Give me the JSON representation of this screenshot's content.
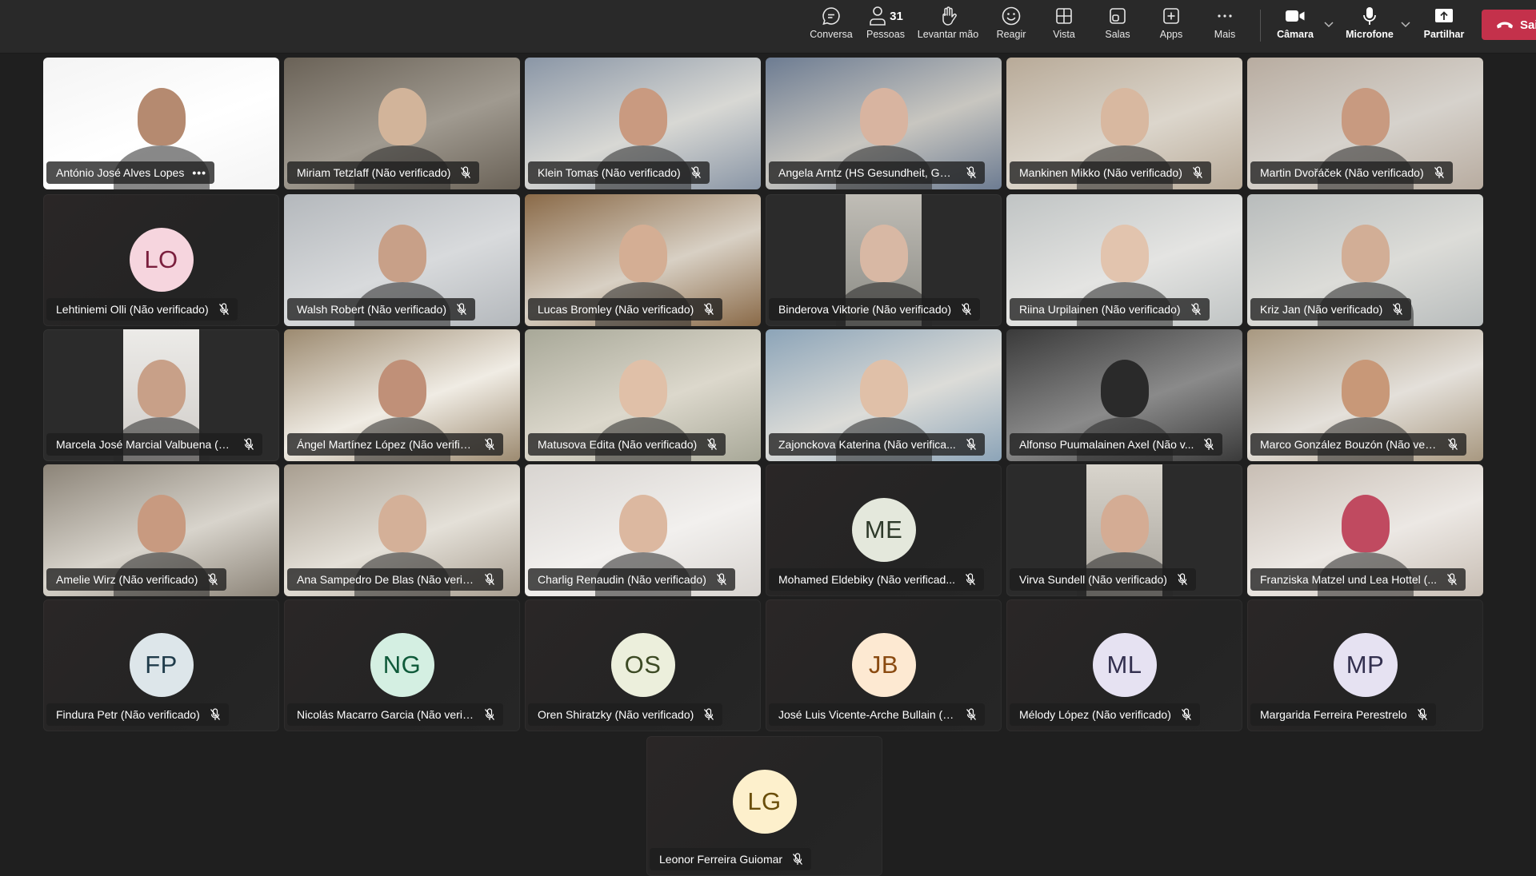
{
  "toolbar": {
    "chat": {
      "label": "Conversa",
      "icon": "chat-icon"
    },
    "people": {
      "label": "Pessoas",
      "count": "31",
      "icon": "people-icon"
    },
    "raise_hand": {
      "label": "Levantar mão",
      "icon": "raise-hand-icon"
    },
    "react": {
      "label": "Reagir",
      "icon": "smiley-icon"
    },
    "view": {
      "label": "Vista",
      "icon": "grid-icon"
    },
    "rooms": {
      "label": "Salas",
      "icon": "breakout-rooms-icon"
    },
    "apps": {
      "label": "Apps",
      "icon": "plus-square-icon"
    },
    "more": {
      "label": "Mais",
      "icon": "ellipsis-icon"
    },
    "camera": {
      "label": "Câmara",
      "icon": "camera-icon"
    },
    "mic": {
      "label": "Microfone",
      "icon": "microphone-icon"
    },
    "share": {
      "label": "Partilhar",
      "icon": "share-screen-icon"
    },
    "leave": {
      "label": "Sair",
      "icon": "hang-up-icon",
      "color": "#c4314b"
    }
  },
  "participants": [
    {
      "name": "António José Alves Lopes",
      "type": "video",
      "muted": false,
      "more": true,
      "bg": [
        "#f4f4f4",
        "#ffffff"
      ],
      "skin": "#b58a70"
    },
    {
      "name": "Miriam Tetzlaff (Não verificado)",
      "type": "video",
      "muted": true,
      "bg": [
        "#6a6257",
        "#a09a90"
      ],
      "skin": "#d2b49a"
    },
    {
      "name": "Klein Tomas (Não verificado)",
      "type": "video",
      "muted": true,
      "bg": [
        "#8a96a6",
        "#d8d8d4"
      ],
      "skin": "#c99a80"
    },
    {
      "name": "Angela Arntz (HS Gesundheit, Ger...",
      "type": "video",
      "muted": true,
      "bg": [
        "#6d7c92",
        "#c8c6c0"
      ],
      "skin": "#d8b4a0"
    },
    {
      "name": "Mankinen Mikko (Não verificado)",
      "type": "video",
      "muted": true,
      "bg": [
        "#b8aa98",
        "#dcd6cc"
      ],
      "skin": "#d8b8a0"
    },
    {
      "name": "Martin Dvořáček (Não verificado)",
      "type": "video",
      "muted": true,
      "bg": [
        "#b8aca0",
        "#d6d2cc"
      ],
      "skin": "#c89a80"
    },
    {
      "name": "Lehtiniemi Olli (Não verificado)",
      "type": "avatar",
      "initials": "LO",
      "muted": true,
      "avatar_bg": "#f6d5de",
      "avatar_fg": "#7a1f3d"
    },
    {
      "name": "Walsh Robert (Não verificado)",
      "type": "video",
      "muted": true,
      "bg": [
        "#b4b8bc",
        "#d8dadc"
      ],
      "skin": "#c8a088"
    },
    {
      "name": "Lucas Bromley (Não verificado)",
      "type": "video",
      "muted": true,
      "bg": [
        "#8a6a48",
        "#d8d0c4"
      ],
      "skin": "#d4ae94"
    },
    {
      "name": "Binderova Viktorie (Não verificado)",
      "type": "portrait",
      "muted": true,
      "bg": [
        "#8a8a84",
        "#c0bdb6"
      ],
      "skin": "#d8b8a4"
    },
    {
      "name": "Riina Urpilainen (Não verificado)",
      "type": "video",
      "muted": true,
      "bg": [
        "#c0c4c4",
        "#e4e4e2"
      ],
      "skin": "#e2c4ae"
    },
    {
      "name": "Kriz Jan (Não verificado)",
      "type": "video",
      "muted": true,
      "bg": [
        "#b8bcbc",
        "#dcdcd8"
      ],
      "skin": "#d2ae96"
    },
    {
      "name": "Marcela José Marcial Valbuena (N...",
      "type": "portrait",
      "muted": true,
      "bg": [
        "#d0ccc8",
        "#ecebe8"
      ],
      "skin": "#c8a088"
    },
    {
      "name": "Ángel Martínez López (Não verific...",
      "type": "video",
      "muted": true,
      "bg": [
        "#9c8a70",
        "#f0ece4"
      ],
      "skin": "#c09078"
    },
    {
      "name": "Matusova Edita (Não verificado)",
      "type": "video",
      "muted": true,
      "bg": [
        "#a8a898",
        "#dcd8cc"
      ],
      "skin": "#e0c0a8"
    },
    {
      "name": "Zajonckova Katerina (Não verifica...",
      "type": "video",
      "muted": true,
      "bg": [
        "#8ca4b8",
        "#dcdcd8"
      ],
      "skin": "#e0c0a8"
    },
    {
      "name": "Alfonso Puumalainen Axel (Não v...",
      "type": "video",
      "muted": true,
      "bg": [
        "#3a3a3a",
        "#8a8a8a"
      ],
      "skin": "#2a2a2a"
    },
    {
      "name": "Marco González Bouzón (Não veri...",
      "type": "video",
      "muted": true,
      "bg": [
        "#a89880",
        "#e4e0da"
      ],
      "skin": "#c89878"
    },
    {
      "name": "Amelie Wirz (Não verificado)",
      "type": "video",
      "muted": true,
      "bg": [
        "#8c8478",
        "#d8d4cc"
      ],
      "skin": "#c89a80"
    },
    {
      "name": "Ana Sampedro De Blas (Não verifi...",
      "type": "video",
      "muted": true,
      "bg": [
        "#a89e90",
        "#e4e0d8"
      ],
      "skin": "#d4b098"
    },
    {
      "name": "Charlig Renaudin (Não verificado)",
      "type": "video",
      "muted": true,
      "bg": [
        "#d8d4d0",
        "#f2f0ee"
      ],
      "skin": "#dcb8a0"
    },
    {
      "name": "Mohamed Eldebiky (Não verificad...",
      "type": "avatar",
      "initials": "ME",
      "muted": true,
      "avatar_bg": "#e4e8dc",
      "avatar_fg": "#2e3a2a"
    },
    {
      "name": "Virva Sundell (Não verificado)",
      "type": "portrait",
      "muted": true,
      "bg": [
        "#a8a49c",
        "#d8d4cc"
      ],
      "skin": "#d4ac94"
    },
    {
      "name": "Franziska Matzel und Lea Hottel (...",
      "type": "video",
      "muted": true,
      "bg": [
        "#c8beb4",
        "#ece8e4"
      ],
      "skin": "#c04a60"
    },
    {
      "name": "Findura Petr (Não verificado)",
      "type": "avatar",
      "initials": "FP",
      "muted": true,
      "avatar_bg": "#dde6ea",
      "avatar_fg": "#1f3b4a"
    },
    {
      "name": "Nicolás Macarro Garcia (Não verif...",
      "type": "avatar",
      "initials": "NG",
      "muted": true,
      "avatar_bg": "#d4efe2",
      "avatar_fg": "#0f5a3a"
    },
    {
      "name": "Oren Shiratzky (Não verificado)",
      "type": "avatar",
      "initials": "OS",
      "muted": true,
      "avatar_bg": "#ecefdc",
      "avatar_fg": "#3c4a24"
    },
    {
      "name": "José Luis Vicente-Arche Bullain (N...",
      "type": "avatar",
      "initials": "JB",
      "muted": true,
      "avatar_bg": "#fde9d2",
      "avatar_fg": "#8a4a10"
    },
    {
      "name": "Mélody López (Não verificado)",
      "type": "avatar",
      "initials": "ML",
      "muted": true,
      "avatar_bg": "#e6e2f2",
      "avatar_fg": "#33304f"
    },
    {
      "name": "Margarida Ferreira Perestrelo",
      "type": "avatar",
      "initials": "MP",
      "muted": true,
      "avatar_bg": "#e6e2f2",
      "avatar_fg": "#33304f"
    },
    {
      "name": "Leonor Ferreira Guiomar",
      "type": "avatar",
      "initials": "LG",
      "muted": true,
      "avatar_bg": "#fdf0cc",
      "avatar_fg": "#6a4e0a"
    }
  ]
}
